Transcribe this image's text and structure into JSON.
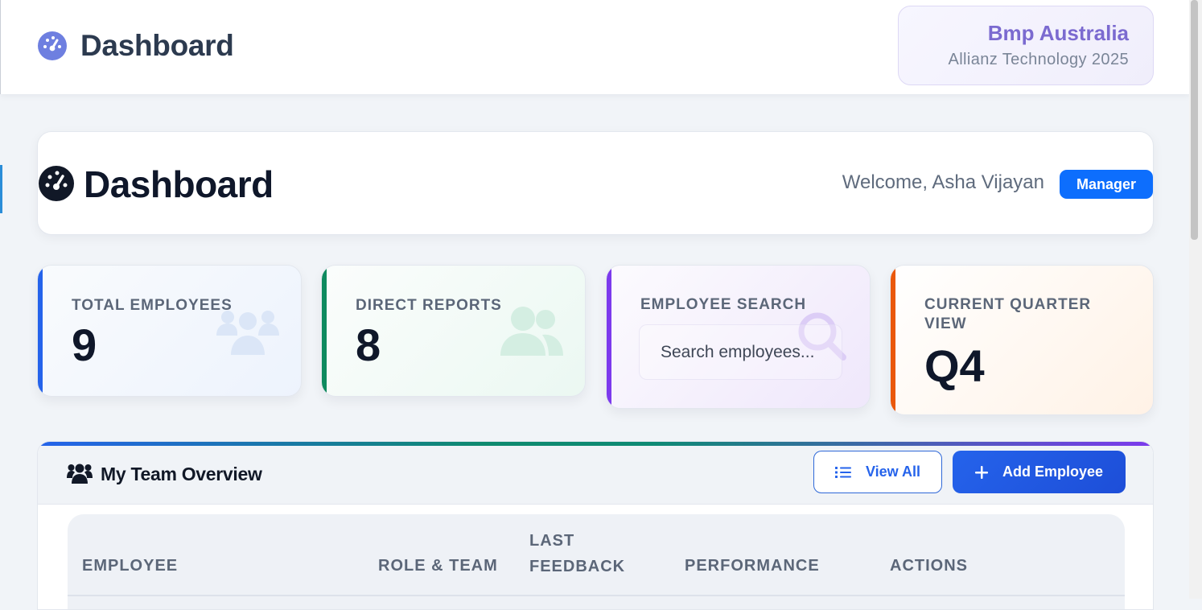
{
  "header": {
    "title": "Dashboard",
    "brand_name": "Bmp Australia",
    "brand_subtitle": "Allianz Technology 2025"
  },
  "welcome": {
    "title": "Dashboard",
    "greeting": "Welcome, Asha Vijayan",
    "role_badge": "Manager"
  },
  "stats": [
    {
      "label": "TOTAL EMPLOYEES",
      "value": "9",
      "accent": "#2563eb",
      "icon": "users-icon"
    },
    {
      "label": "DIRECT REPORTS",
      "value": "8",
      "accent": "#0e8a5f",
      "icon": "user-group-icon"
    },
    {
      "label": "EMPLOYEE SEARCH",
      "placeholder": "Search employees...",
      "accent": "#7c3aed",
      "icon": "search-icon"
    },
    {
      "label": "CURRENT QUARTER VIEW",
      "value": "Q4",
      "accent": "#ea580c"
    }
  ],
  "team": {
    "title": "My Team Overview",
    "view_all_label": "View All",
    "add_employee_label": "Add Employee",
    "columns": [
      "EMPLOYEE",
      "ROLE & TEAM",
      "LAST FEEDBACK",
      "PERFORMANCE",
      "ACTIONS"
    ]
  },
  "colors": {
    "primary": "#0d6efd",
    "brand": "#7b6ad0",
    "text_dark": "#0f172a"
  }
}
